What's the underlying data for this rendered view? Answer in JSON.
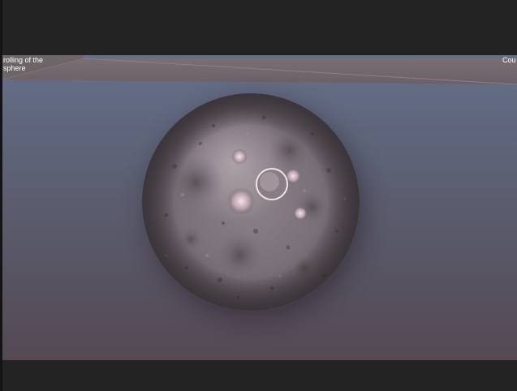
{
  "hud": {
    "left_text": "rolling of the\nsphere",
    "right_text": "Cou"
  },
  "scene": {
    "object": "cratered-moon-sphere-icon",
    "colors": {
      "background_bar": "#232323",
      "floor_top": "#606a7d",
      "floor_bottom": "#534a55",
      "wall": "#6a6268",
      "sphere": "#7a7078"
    }
  }
}
